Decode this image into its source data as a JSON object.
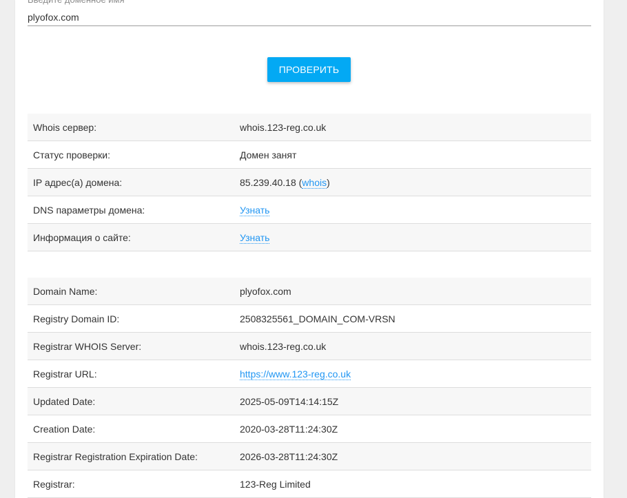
{
  "form": {
    "label": "Введите доменное имя",
    "domain_value": "plyofox.com",
    "button_label": "ПРОВЕРИТЬ"
  },
  "status_table": [
    {
      "key": "Whois сервер:",
      "value": "whois.123-reg.co.uk"
    },
    {
      "key": "Статус проверки:",
      "value": "Домен занят"
    },
    {
      "key": "IP адрес(а) домена:",
      "value_prefix": "85.239.40.18 (",
      "link": "whois",
      "value_suffix": ")"
    },
    {
      "key": "DNS параметры домена:",
      "link": "Узнать"
    },
    {
      "key": "Информация о сайте:",
      "link": "Узнать"
    }
  ],
  "whois_table": [
    {
      "key": "Domain Name:",
      "value": "plyofox.com"
    },
    {
      "key": "Registry Domain ID:",
      "value": "2508325561_DOMAIN_COM-VRSN"
    },
    {
      "key": "Registrar WHOIS Server:",
      "value": "whois.123-reg.co.uk"
    },
    {
      "key": "Registrar URL:",
      "link": "https://www.123-reg.co.uk"
    },
    {
      "key": "Updated Date:",
      "value": "2025-05-09T14:14:15Z"
    },
    {
      "key": "Creation Date:",
      "value": "2020-03-28T11:24:30Z"
    },
    {
      "key": "Registrar Registration Expiration Date:",
      "value": "2026-03-28T11:24:30Z"
    },
    {
      "key": "Registrar:",
      "value": "123-Reg Limited"
    }
  ],
  "colors": {
    "accent": "#03a9f4",
    "link": "#2196f3",
    "row_stripe": "#f7f7f7",
    "background": "#efefef"
  }
}
